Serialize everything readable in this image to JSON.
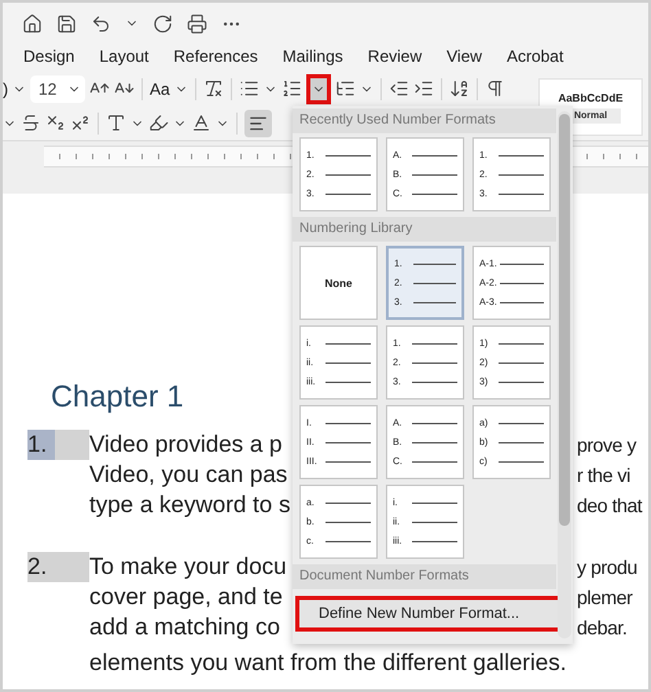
{
  "menu_tabs": [
    "Design",
    "Layout",
    "References",
    "Mailings",
    "Review",
    "View",
    "Acrobat"
  ],
  "ribbon": {
    "font_name": ")",
    "font_size": "12",
    "change_case": "Aa",
    "numbering_caret_highlighted": true,
    "align_left_on": true,
    "style_preview": "AaBbCcDdE",
    "style_name": "Normal"
  },
  "document": {
    "heading": "Chapter 1",
    "list": [
      {
        "number": "1.",
        "selected": true,
        "lines": [
          {
            "kind": "split",
            "left": "Video provides a p",
            "right": "prove y"
          },
          {
            "kind": "split",
            "left": "Video, you can pas",
            "right": "r the vi"
          },
          {
            "kind": "split",
            "left": "type a keyword to s",
            "right": "deo that"
          }
        ]
      },
      {
        "number": "2.",
        "selected": false,
        "lines": [
          {
            "kind": "split",
            "left": "To make your docu",
            "right": "y produ"
          },
          {
            "kind": "split",
            "left": "cover page, and te",
            "right": "plemer"
          },
          {
            "kind": "split",
            "left": "add a matching co",
            "right": "debar."
          },
          {
            "kind": "full",
            "left": "elements you want from the different galleries."
          }
        ]
      }
    ]
  },
  "numbering_menu": {
    "sections": [
      {
        "title": "Recently Used Number Formats",
        "tiles": [
          {
            "kind": "list",
            "markers": [
              "1.",
              "2.",
              "3."
            ],
            "selected": false
          },
          {
            "kind": "list",
            "markers": [
              "A.",
              "B.",
              "C."
            ],
            "selected": false
          },
          {
            "kind": "list",
            "markers": [
              "1.",
              "2.",
              "3."
            ],
            "selected": false
          }
        ]
      },
      {
        "title": "Numbering Library",
        "tiles": [
          {
            "kind": "none",
            "label": "None",
            "selected": false
          },
          {
            "kind": "list",
            "markers": [
              "1.",
              "2.",
              "3."
            ],
            "selected": true
          },
          {
            "kind": "list",
            "markers": [
              "A-1.",
              "A-2.",
              "A-3."
            ],
            "selected": false
          },
          {
            "kind": "list",
            "markers": [
              "i.",
              "ii.",
              "iii."
            ],
            "selected": false
          },
          {
            "kind": "list",
            "markers": [
              "1.",
              "2.",
              "3."
            ],
            "selected": false
          },
          {
            "kind": "list",
            "markers": [
              "1)",
              "2)",
              "3)"
            ],
            "selected": false
          },
          {
            "kind": "list",
            "markers": [
              "I.",
              "II.",
              "III."
            ],
            "selected": false
          },
          {
            "kind": "list",
            "markers": [
              "A.",
              "B.",
              "C."
            ],
            "selected": false
          },
          {
            "kind": "list",
            "markers": [
              "a)",
              "b)",
              "c)"
            ],
            "selected": false
          },
          {
            "kind": "list",
            "markers": [
              "a.",
              "b.",
              "c."
            ],
            "selected": false
          },
          {
            "kind": "list",
            "markers": [
              "i.",
              "ii.",
              "iii."
            ],
            "selected": false
          }
        ]
      },
      {
        "title": "Document Number Formats"
      }
    ],
    "define_button": {
      "label": "Define New Number Format...",
      "highlighted": true
    }
  }
}
